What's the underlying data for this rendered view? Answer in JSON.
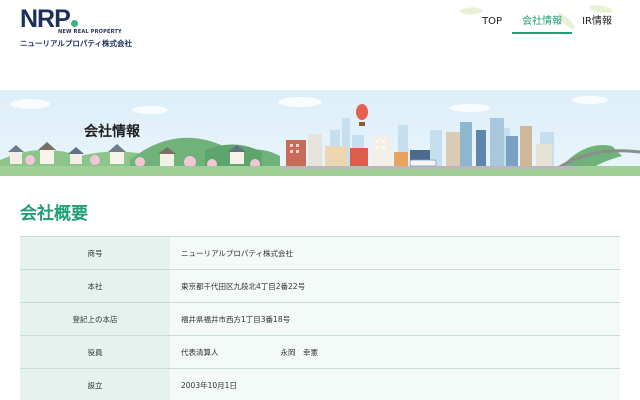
{
  "header": {
    "logo_mark": "NRP",
    "logo_sub": "NEW REAL PROPERTY",
    "logo_jp": "ニューリアルプロパティ株式会社",
    "nav": [
      {
        "label": "TOP"
      },
      {
        "label": "会社情報"
      },
      {
        "label": "IR情報"
      }
    ]
  },
  "banner": {
    "title": "会社情報"
  },
  "section": {
    "title": "会社概要"
  },
  "table": {
    "rows": [
      {
        "label": "商号",
        "value": "ニューリアルプロパティ株式会社"
      },
      {
        "label": "本社",
        "value": "東京都千代田区九段北4丁目2番22号"
      },
      {
        "label": "登記上の本店",
        "value": "福井県福井市西方1丁目3番18号"
      },
      {
        "label": "役員",
        "value": "代表清算人",
        "value2": "永岡　幸憲"
      },
      {
        "label": "設立",
        "value": "2003年10月1日"
      }
    ]
  },
  "colors": {
    "accent": "#1f9f74",
    "brand": "#1d2f5a",
    "table_header_bg": "#e5f2ed",
    "table_cell_bg": "#f3faf7"
  }
}
